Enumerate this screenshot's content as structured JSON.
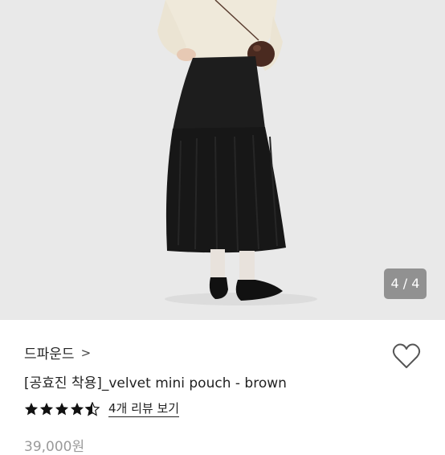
{
  "gallery": {
    "counter": "4 / 4",
    "image_description": "model wearing cream knit sweater, black tiered maxi skirt, white socks, black mary-jane flats, small brown velvet pouch"
  },
  "product": {
    "brand": "드파운드",
    "brand_chevron": ">",
    "title": "[공효진 착용]_velvet mini pouch - brown",
    "rating": 4.5,
    "review_link": "4개 리뷰 보기",
    "price": "39,000원"
  },
  "colors": {
    "star": "#111111",
    "photo_bg": "#e9e9e9",
    "counter_bg": "#7a7a7a"
  },
  "icons": {
    "wishlist": "heart-outline-icon",
    "star": "star-icon"
  }
}
